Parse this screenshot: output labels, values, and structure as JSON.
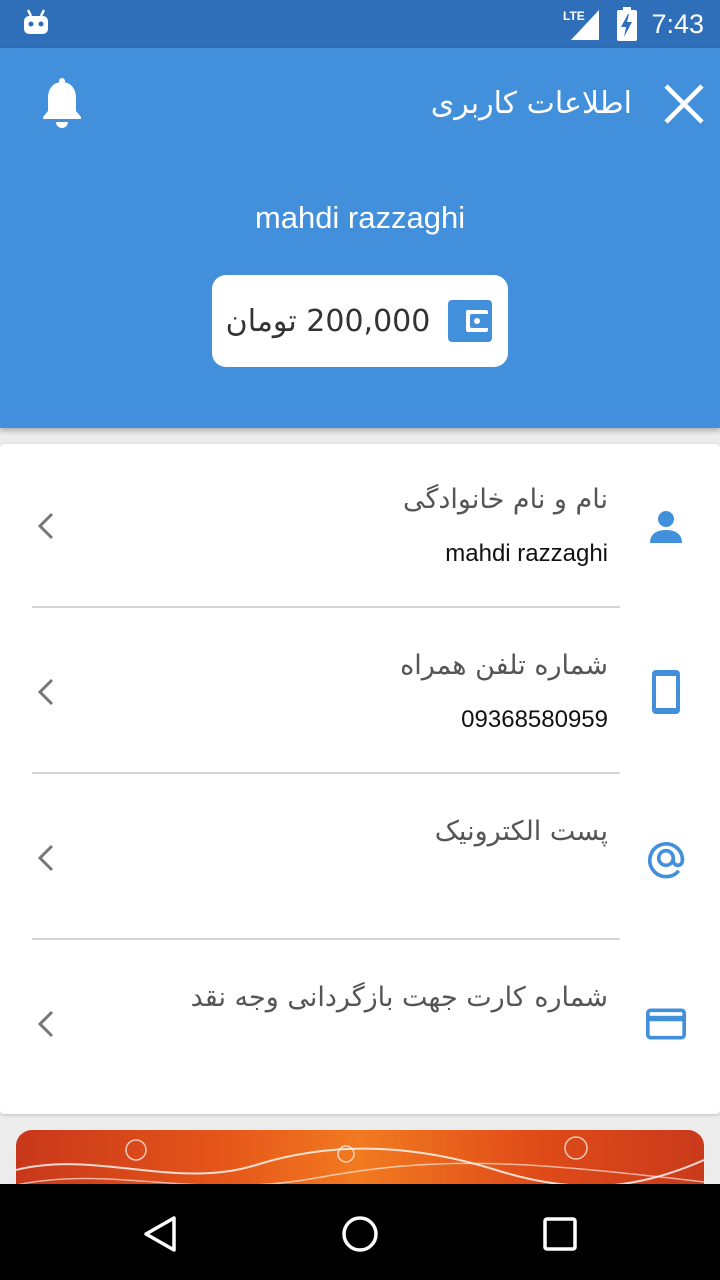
{
  "status_bar": {
    "network": "LTE",
    "time": "7:43"
  },
  "header": {
    "title": "اطلاعات کاربری",
    "username": "mahdi razzaghi",
    "wallet_amount": "200,000 تومان",
    "accent_color": "#428fdc"
  },
  "fields": [
    {
      "label": "نام و نام خانوادگی",
      "value": "mahdi razzaghi",
      "icon": "person-icon"
    },
    {
      "label": "شماره تلفن همراه",
      "value": "09368580959",
      "icon": "phone-icon"
    },
    {
      "label": "پست الکترونیک",
      "value": "",
      "icon": "at-sign-icon"
    },
    {
      "label": "شماره کارت جهت بازگردانی وجه نقد",
      "value": "",
      "icon": "credit-card-icon"
    }
  ]
}
